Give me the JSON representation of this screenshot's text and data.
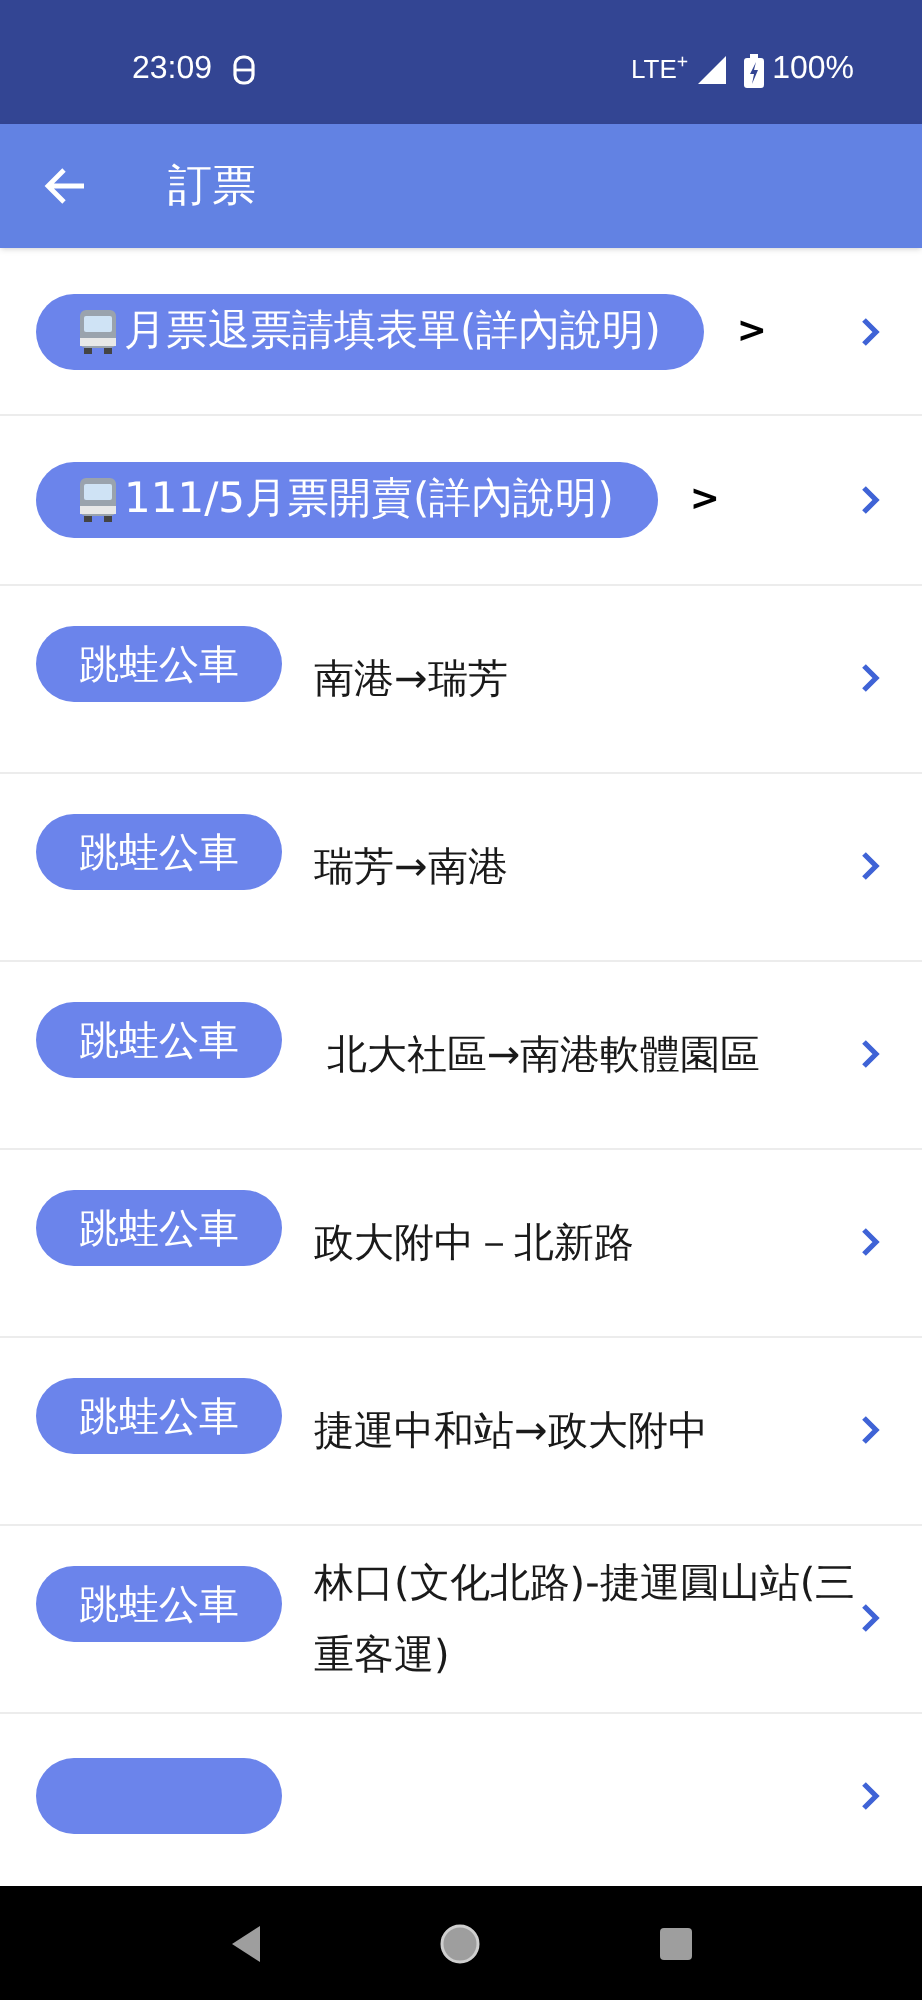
{
  "status_bar": {
    "time": "23:09",
    "network": "LTE$^{+}$",
    "battery": "100%"
  },
  "app_bar": {
    "title": "訂票"
  },
  "rows": [
    {
      "kind": "banner",
      "label": "月票退票請填表單(詳內說明)",
      "suffix": ">"
    },
    {
      "kind": "banner",
      "label": "111/5月票開賣(詳內說明)",
      "suffix": ">"
    },
    {
      "kind": "route",
      "tag": "跳蛙公車",
      "title": "南港→瑞芳"
    },
    {
      "kind": "route",
      "tag": "跳蛙公車",
      "title": "瑞芳→南港"
    },
    {
      "kind": "route",
      "tag": "跳蛙公車",
      "title": " 北大社區→南港軟體園區"
    },
    {
      "kind": "route",
      "tag": "跳蛙公車",
      "title": "政大附中－北新路"
    },
    {
      "kind": "route",
      "tag": "跳蛙公車",
      "title": "捷運中和站→政大附中"
    },
    {
      "kind": "route",
      "tag": "跳蛙公車",
      "title": "林口(文化北路)-捷運圓山站(三重客運)"
    },
    {
      "kind": "partial"
    }
  ]
}
